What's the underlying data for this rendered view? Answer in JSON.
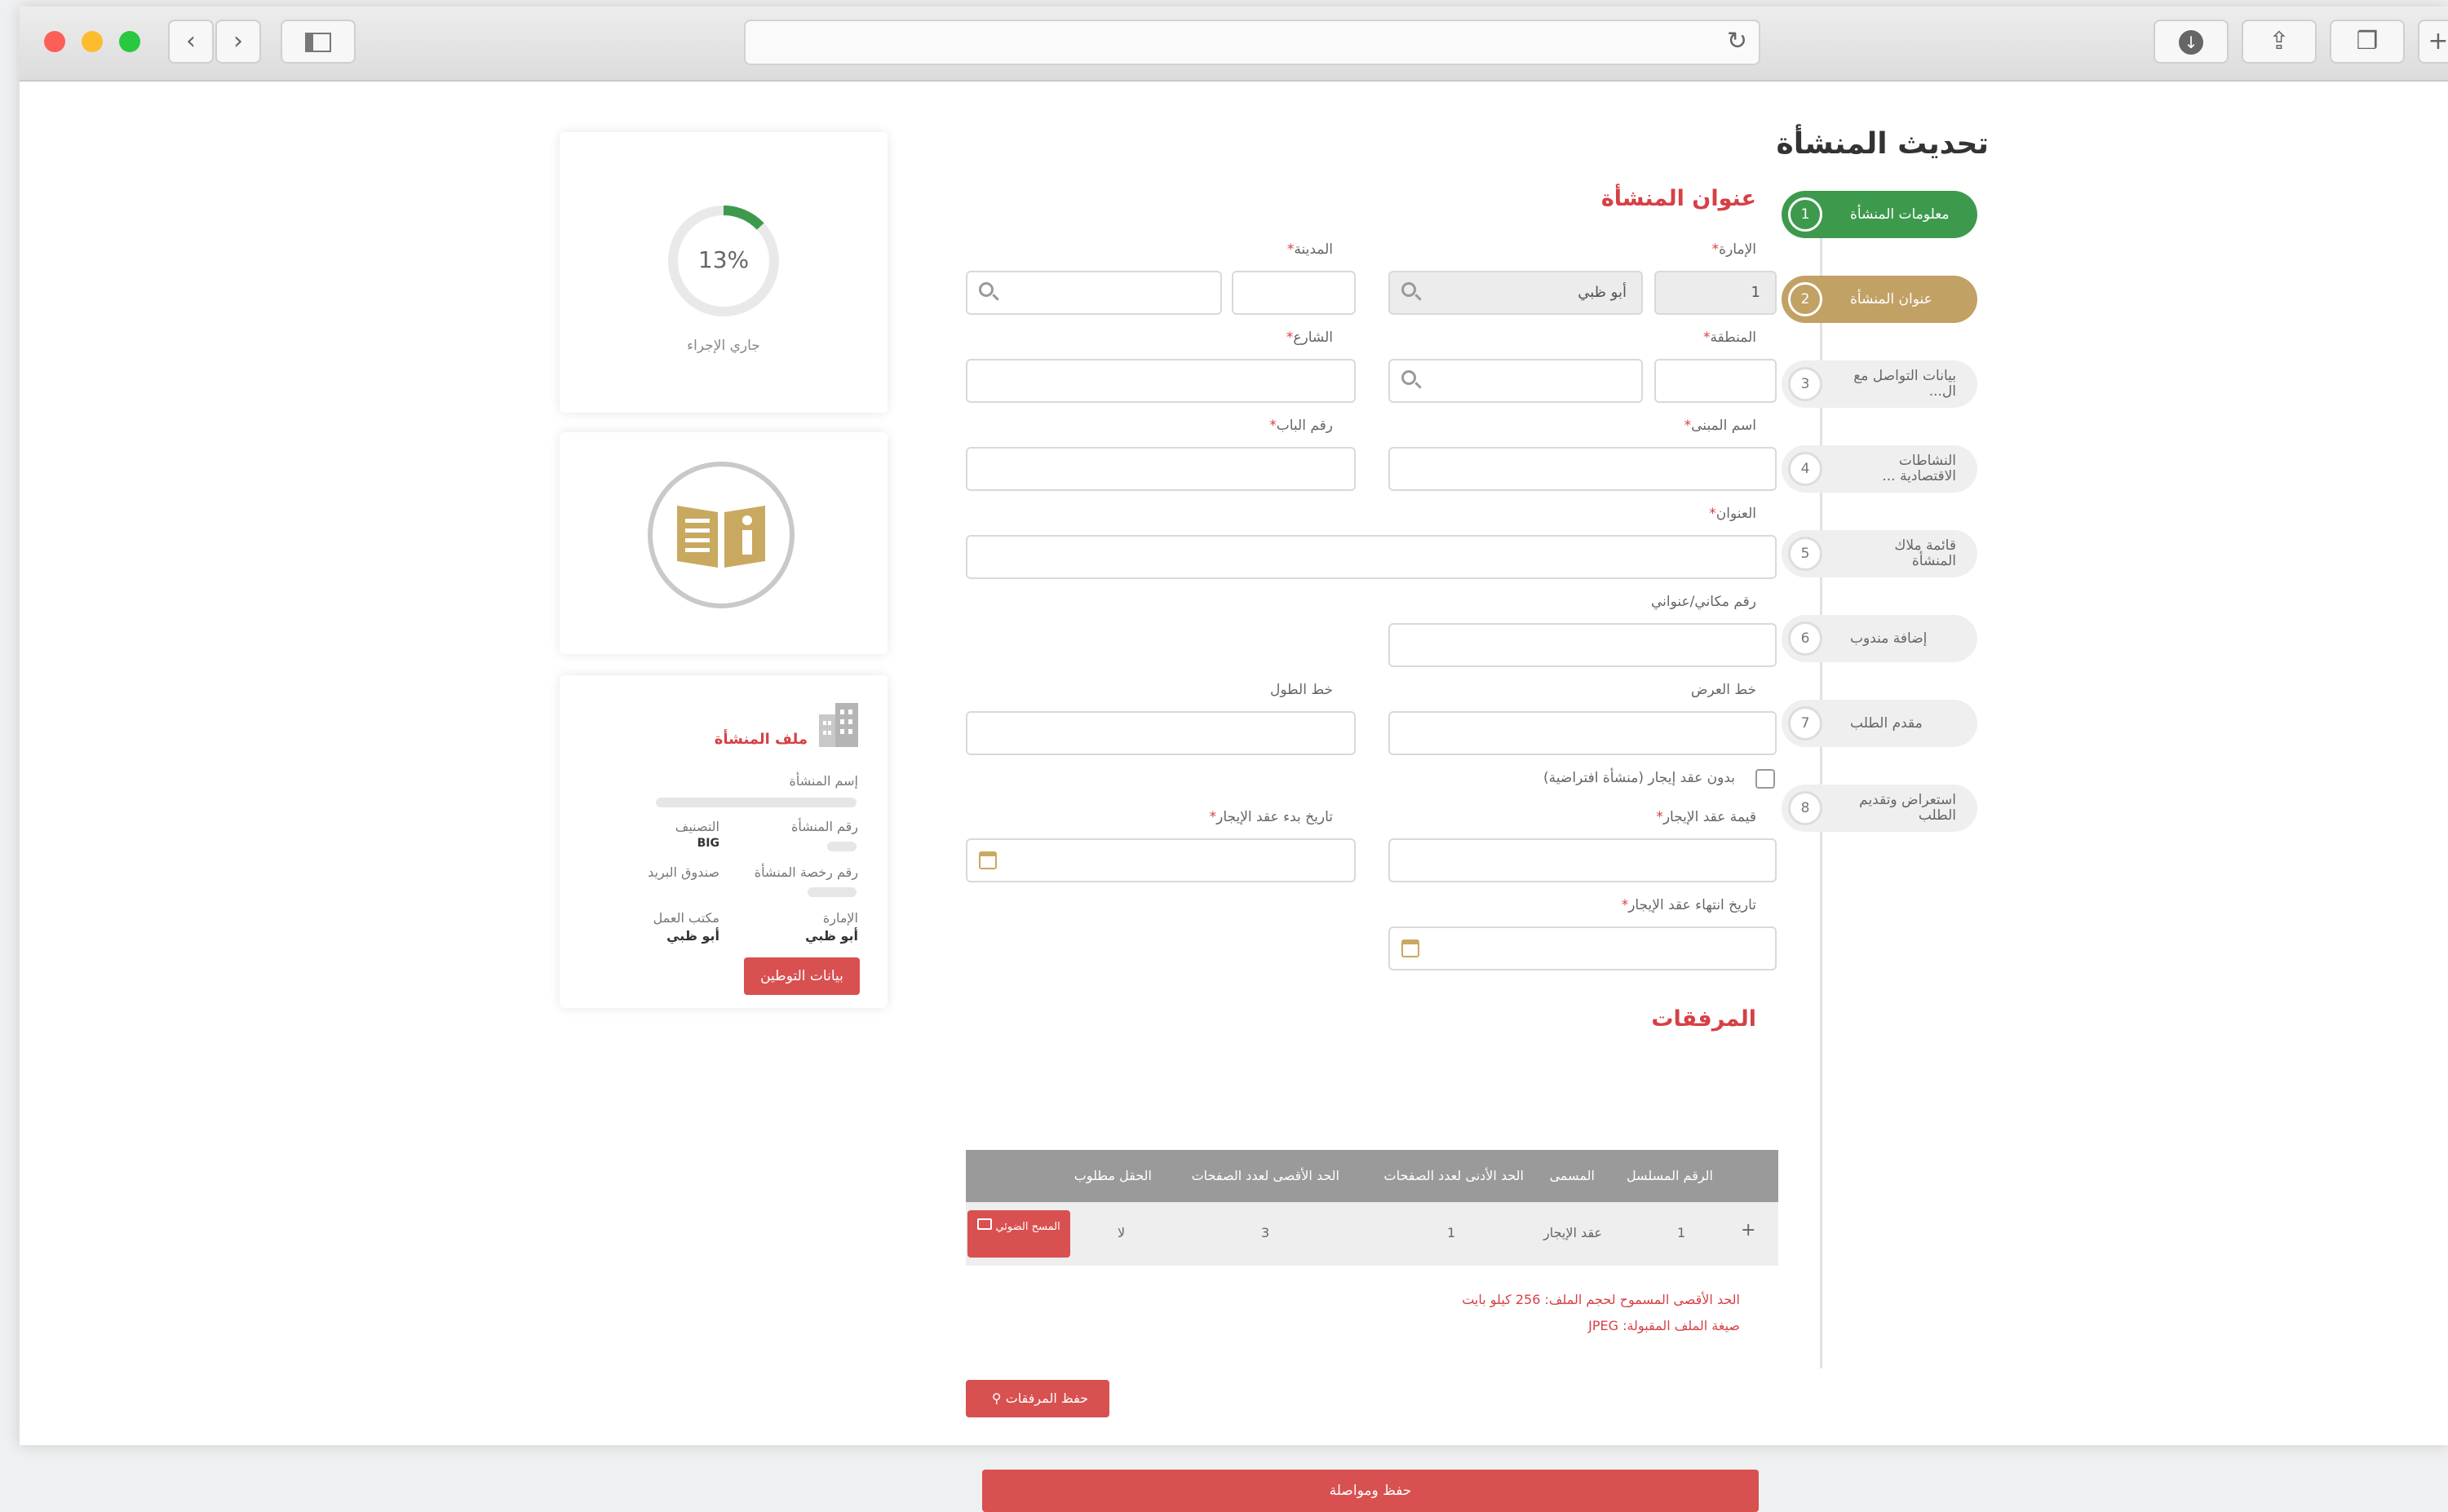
{
  "page": {
    "title": "تحديث المنشأة",
    "section_title": "عنوان المنشأة"
  },
  "steps": [
    {
      "num": "1",
      "label": "معلومات المنشأة",
      "state": "done"
    },
    {
      "num": "2",
      "label": "عنوان المنشأة",
      "state": "active"
    },
    {
      "num": "3",
      "label": "بيانات التواصل مع ال...",
      "state": "pending"
    },
    {
      "num": "4",
      "label": "النشاطات الاقتصادية ...",
      "state": "pending"
    },
    {
      "num": "5",
      "label": "قائمة ملاك المنشأة",
      "state": "pending"
    },
    {
      "num": "6",
      "label": "إضافة مندوب",
      "state": "pending"
    },
    {
      "num": "7",
      "label": "مقدم الطلب",
      "state": "pending"
    },
    {
      "num": "8",
      "label": "استعراض وتقديم الطلب",
      "state": "pending"
    }
  ],
  "form": {
    "emirate_label": "الإمارة",
    "emirate_code": "1",
    "emirate_value": "أبو ظبي",
    "city_label": "المدينة",
    "area_label": "المنطقة",
    "street_label": "الشارع",
    "building_label": "اسم المبنى",
    "door_label": "رقم الباب",
    "address_label": "العنوان",
    "makani_label": "رقم مكاني/عنواني",
    "latitude_label": "خط العرض",
    "longitude_label": "خط الطول",
    "no_lease_label": "بدون عقد إيجار (منشأة افتراضية)",
    "lease_value_label": "قيمة عقد الإيجار",
    "lease_start_label": "تاريخ بدء عقد الإيجار",
    "lease_end_label": "تاريخ انتهاء عقد الإيجار",
    "required_mark": "*"
  },
  "attachments": {
    "title": "المرفقات",
    "columns": [
      "الرقم المسلسل",
      "المسمى",
      "الحد الأدنى لعدد الصفحات",
      "الحد الأقصى لعدد الصفحات",
      "الحقل مطلوب"
    ],
    "rows": [
      {
        "serial": "1",
        "name": "عقد الإيجار",
        "min_pages": "1",
        "max_pages": "3",
        "required": "لا"
      }
    ],
    "scan_button": "المسح الضوئي",
    "add_icon": "+",
    "max_size_note": "الحد الأقصى المسموح لحجم الملف: 256 كيلو بايت",
    "format_note": "صيغة الملف المقبولة: JPEG",
    "save_attachments_button": "حفظ المرفقات"
  },
  "save_continue_button": "حفظ ومواصلة",
  "progress": {
    "percent_text": "13%",
    "percent_value": 13,
    "status": "جاري الإجراء",
    "color": "#3d9a4d"
  },
  "profile": {
    "title": "ملف المنشأة",
    "name_label": "إسم المنشأة",
    "number_label": "رقم المنشأة",
    "classification_label": "التصنيف",
    "classification_value": "BIG",
    "license_label": "رقم رخصة المنشأة",
    "pobox_label": "صندوق البريد",
    "emirate_label": "الإمارة",
    "emirate_value": "أبو ظبي",
    "office_label": "مكتب العمل",
    "office_value": "أبو ظبي",
    "button": "بيانات التوطين"
  },
  "colors": {
    "accent_red": "#d64045",
    "step_green": "#3d9a4d",
    "step_gold": "#c2a165",
    "icon_gold": "#c9a960"
  }
}
